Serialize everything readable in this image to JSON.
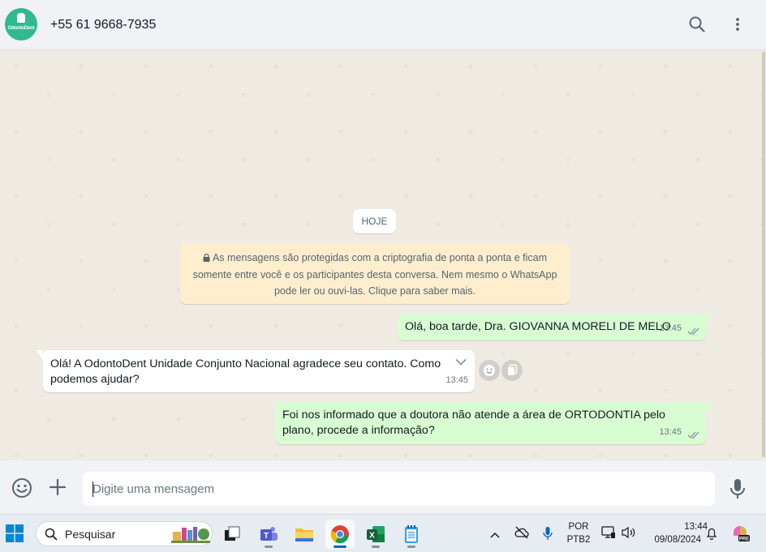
{
  "header": {
    "contact_name": "+55 61 9668-7935",
    "avatar_logo_text": "OdontoDent"
  },
  "chat": {
    "date_chip": "HOJE",
    "encryption_notice": "As mensagens são protegidas com a criptografia de ponta a ponta e ficam somente entre você e os participantes desta conversa. Nem mesmo o WhatsApp pode ler ou ouvi-las. Clique para saber mais.",
    "messages": [
      {
        "direction": "outgoing",
        "text": "Olá, boa tarde, Dra. GIOVANNA MORELI DE MELO",
        "time": "13:45",
        "status": "read"
      },
      {
        "direction": "incoming",
        "text": "Olá! A OdontoDent Unidade Conjunto Nacional agradece seu contato. Como podemos ajudar?",
        "time": "13:45"
      },
      {
        "direction": "outgoing",
        "text": "Foi nos informado que a doutora não atende a área de ORTODONTIA pelo plano, procede a informação?",
        "time": "13:45",
        "status": "read"
      }
    ]
  },
  "composer": {
    "placeholder": "Digite uma mensagem",
    "value": ""
  },
  "taskbar": {
    "search_label": "Pesquisar",
    "language": "POR",
    "keyboard": "PTB2",
    "time": "13:44",
    "date": "09/08/2024",
    "copilot_badge": "PRE"
  },
  "colors": {
    "outgoing_bubble": "#d9fdd3",
    "incoming_bubble": "#ffffff",
    "notice_bg": "#ffeecd",
    "chat_bg": "#efeae2",
    "read_ticks": "#53bdeb"
  }
}
